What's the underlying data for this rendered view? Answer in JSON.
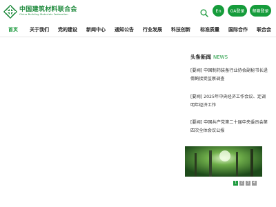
{
  "header": {
    "logo_cn": "中国建筑材料联合会",
    "logo_en": "China Building Materials Federation",
    "lang_label": "En",
    "oa_label": "OA登录",
    "mail_label": "邮箱登录"
  },
  "nav": {
    "items": [
      "首页",
      "关于我们",
      "党的建设",
      "新闻中心",
      "通知公告",
      "行业发展",
      "科技创新",
      "标准质量",
      "国际合作",
      "联合会"
    ],
    "active_index": 0
  },
  "headlines": {
    "title_cn": "头条新闻",
    "title_en": "NEWS",
    "items": [
      "[要闻] 中国制药装备行业协会副秘书长逯倩鹤接受监察调查",
      "[要闻] 2025年中央经济工作会议、定调明年经济工作",
      "[要闻] 中国共产党第二十届中央委员会第四次全体会议公报"
    ]
  },
  "pager": [
    "1",
    "2",
    "3",
    "4"
  ],
  "colors": {
    "accent": "#1e9a3f"
  }
}
